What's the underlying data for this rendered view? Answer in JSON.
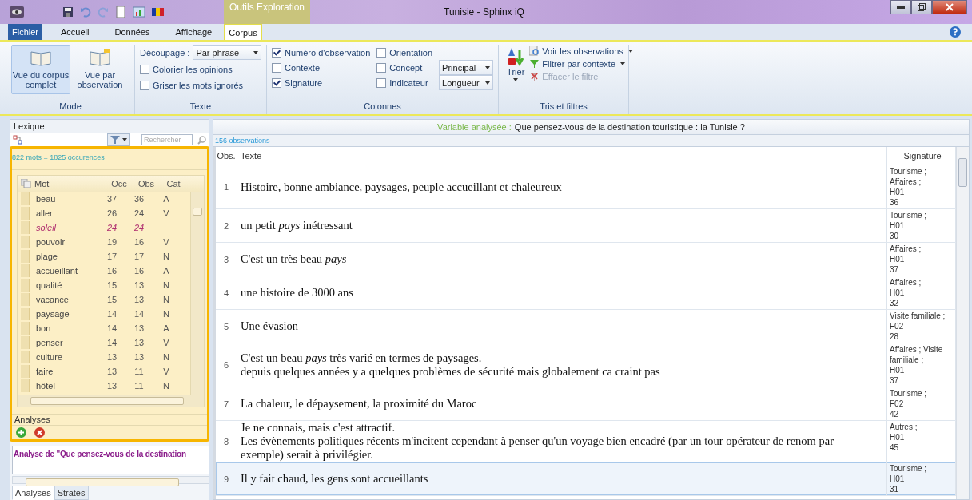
{
  "window": {
    "title": "Tunisie - Sphinx iQ",
    "context_tab": "Outils Exploration"
  },
  "menu_tabs": [
    {
      "label": "Fichier",
      "kind": "file",
      "selected": false
    },
    {
      "label": "Accueil",
      "kind": "tab",
      "selected": false
    },
    {
      "label": "Données",
      "kind": "tab",
      "selected": false
    },
    {
      "label": "Affichage",
      "kind": "tab",
      "selected": false
    },
    {
      "label": "Corpus",
      "kind": "context",
      "selected": true
    }
  ],
  "ribbon": {
    "mode": {
      "title": "Mode",
      "buttons": [
        {
          "label": "Vue du corpus complet",
          "selected": true
        },
        {
          "label": "Vue par observation",
          "selected": false
        }
      ]
    },
    "texte": {
      "title": "Texte",
      "decoupage_label": "Découpage :",
      "decoupage_value": "Par phrase",
      "options": [
        {
          "label": "Colorier les opinions",
          "checked": false
        },
        {
          "label": "Griser les mots ignorés",
          "checked": false
        }
      ]
    },
    "colonnes": {
      "title": "Colonnes",
      "options": [
        {
          "label": "Numéro d'observation",
          "checked": true
        },
        {
          "label": "Contexte",
          "checked": false
        },
        {
          "label": "Signature",
          "checked": true
        },
        {
          "label": "Orientation",
          "checked": false
        },
        {
          "label": "Concept",
          "checked": false
        },
        {
          "label": "Indicateur",
          "checked": false
        }
      ],
      "selects": [
        "Principal",
        "Longueur"
      ]
    },
    "tris": {
      "title": "Tris et filtres",
      "sort_label": "Trier",
      "actions": [
        {
          "label": "Voir les observations",
          "disabled": false
        },
        {
          "label": "Filtrer par contexte",
          "disabled": false
        },
        {
          "label": "Effacer le filtre",
          "disabled": true
        }
      ]
    }
  },
  "lexique": {
    "title": "Lexique",
    "search_placeholder": "Rechercher",
    "summary": "822 mots = 1825 occurences",
    "columns": [
      "Mot",
      "Occ",
      "Obs",
      "Cat"
    ],
    "rows": [
      {
        "mot": "beau",
        "occ": "37",
        "obs": "36",
        "cat": "A",
        "highlighted": false
      },
      {
        "mot": "aller",
        "occ": "26",
        "obs": "24",
        "cat": "V",
        "highlighted": false
      },
      {
        "mot": "soleil",
        "occ": "24",
        "obs": "24",
        "highlighted": true
      },
      {
        "mot": "pouvoir",
        "occ": "19",
        "obs": "16",
        "cat": "V",
        "highlighted": false
      },
      {
        "mot": "plage",
        "occ": "17",
        "obs": "17",
        "cat": "N",
        "highlighted": false
      },
      {
        "mot": "accueillant",
        "occ": "16",
        "obs": "16",
        "cat": "A",
        "highlighted": false
      },
      {
        "mot": "qualité",
        "occ": "15",
        "obs": "13",
        "cat": "N",
        "highlighted": false
      },
      {
        "mot": "vacance",
        "occ": "15",
        "obs": "13",
        "cat": "N",
        "highlighted": false
      },
      {
        "mot": "paysage",
        "occ": "14",
        "obs": "14",
        "cat": "N",
        "highlighted": false
      },
      {
        "mot": "bon",
        "occ": "14",
        "obs": "13",
        "cat": "A",
        "highlighted": false
      },
      {
        "mot": "penser",
        "occ": "14",
        "obs": "13",
        "cat": "V",
        "highlighted": false
      },
      {
        "mot": "culture",
        "occ": "13",
        "obs": "13",
        "cat": "N",
        "highlighted": false
      },
      {
        "mot": "faire",
        "occ": "13",
        "obs": "11",
        "cat": "V",
        "highlighted": false
      },
      {
        "mot": "hôtel",
        "occ": "13",
        "obs": "11",
        "cat": "N",
        "highlighted": false
      }
    ]
  },
  "analyses": {
    "title": "Analyses",
    "items": [
      "Analyse de \"Que pensez-vous de la destination"
    ],
    "bottom_tabs": [
      {
        "label": "Analyses",
        "selected": true
      },
      {
        "label": "Strates",
        "selected": false
      }
    ]
  },
  "corpus": {
    "variable_label": "Variable analysée :",
    "variable": "Que pensez-vous de la destination touristique : la Tunisie ?",
    "count": "156 observations",
    "columns": [
      "Obs.",
      "Texte",
      "Signature"
    ],
    "rows": [
      {
        "obs": "1",
        "lines": [
          "Histoire, bonne ambiance, paysages, peuple accueillant et chaleureux"
        ],
        "signature": [
          "Tourisme ;",
          "Affaires ;",
          "H01",
          "36"
        ],
        "selected": false
      },
      {
        "obs": "2",
        "lines": [
          "un petit *pays* inétressant"
        ],
        "signature": [
          "Tourisme ;",
          "H01",
          "30"
        ],
        "selected": false
      },
      {
        "obs": "3",
        "lines": [
          "C'est un très beau *pays*"
        ],
        "signature": [
          "Affaires ;",
          "H01",
          "37"
        ],
        "selected": false
      },
      {
        "obs": "4",
        "lines": [
          "une histoire de 3000 ans"
        ],
        "signature": [
          "Affaires ;",
          "H01",
          "32"
        ],
        "selected": false
      },
      {
        "obs": "5",
        "lines": [
          "Une évasion"
        ],
        "signature": [
          "Visite familiale ;",
          "F02",
          "28"
        ],
        "selected": false
      },
      {
        "obs": "6",
        "lines": [
          "C'est un beau *pays* très varié en termes de paysages.",
          "depuis quelques années y a quelques problèmes de sécurité mais globalement ca craint pas"
        ],
        "signature": [
          "Affaires ; Visite",
          "familiale ;",
          "H01",
          "37"
        ],
        "selected": false
      },
      {
        "obs": "7",
        "lines": [
          "La chaleur, le dépaysement, la proximité du Maroc"
        ],
        "signature": [
          "Tourisme ;",
          "F02",
          "42"
        ],
        "selected": false
      },
      {
        "obs": "8",
        "lines": [
          "Je ne connais, mais c'est attractif.",
          "Les évènements politiques récents m'incitent cependant à penser qu'un voyage bien encadré (par un tour opérateur de renom par",
          "exemple) serait à privilégier."
        ],
        "signature": [
          "Autres ;",
          "H01",
          "45"
        ],
        "selected": false
      },
      {
        "obs": "9",
        "lines": [
          "Il y fait chaud, les gens sont accueillants"
        ],
        "signature": [
          "Tourisme ;",
          "H01",
          "31"
        ],
        "selected": true
      }
    ]
  }
}
